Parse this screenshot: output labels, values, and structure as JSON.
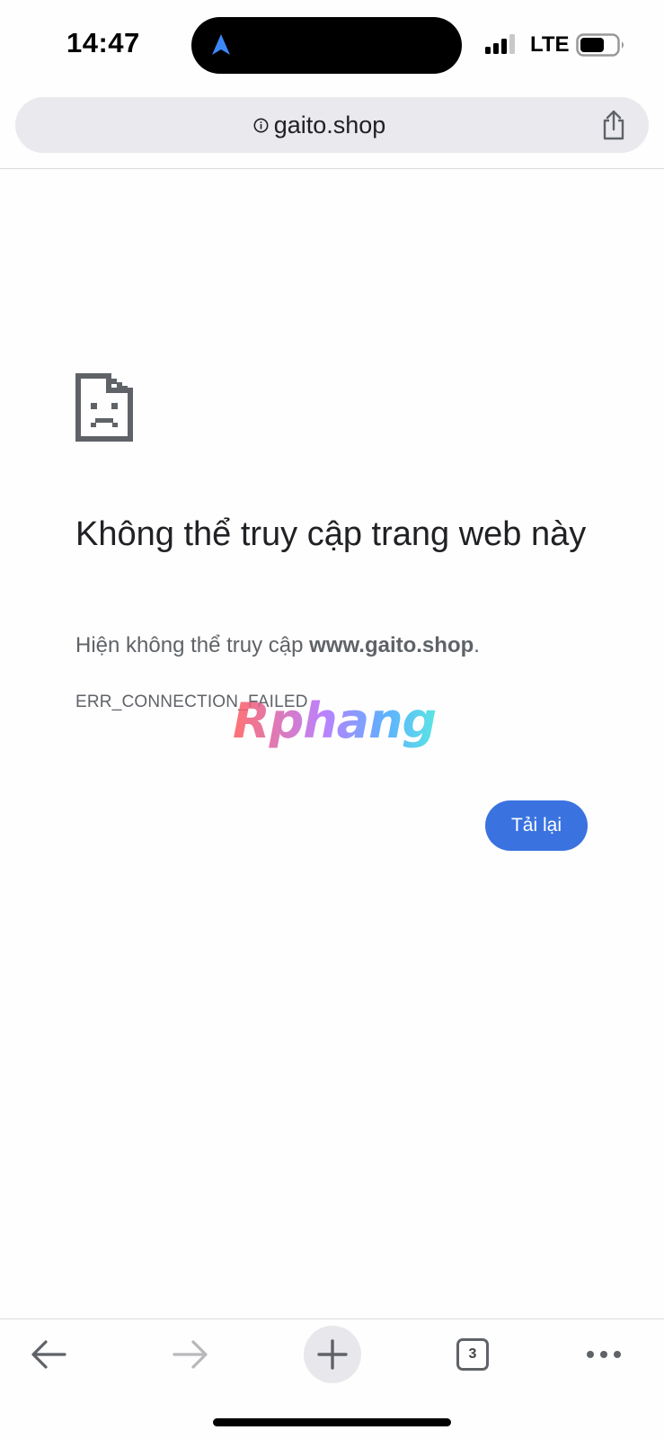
{
  "status_bar": {
    "time": "14:47",
    "network": "LTE",
    "icons": [
      "location-arrow-icon",
      "signal-icon",
      "battery-icon"
    ]
  },
  "url_bar": {
    "url": "gaito.shop",
    "icons": [
      "info-icon",
      "share-icon"
    ]
  },
  "error_page": {
    "icon": "sad-document-icon",
    "heading": "Không thể truy cập trang web này",
    "description_prefix": "Hiện không thể truy cập ",
    "description_domain": "www.gaito.shop",
    "description_suffix": ".",
    "error_code": "ERR_CONNECTION_FAILED",
    "reload_label": "Tải lại"
  },
  "watermark": "Rphang",
  "toolbar": {
    "tab_count": "3",
    "icons": [
      "back-arrow-icon",
      "forward-arrow-icon",
      "plus-icon",
      "tab-switcher-icon",
      "more-dots-icon"
    ]
  },
  "colors": {
    "accent": "#3a73e0",
    "url_bar_bg": "#e9e9ee",
    "text_secondary": "#5f6368"
  }
}
